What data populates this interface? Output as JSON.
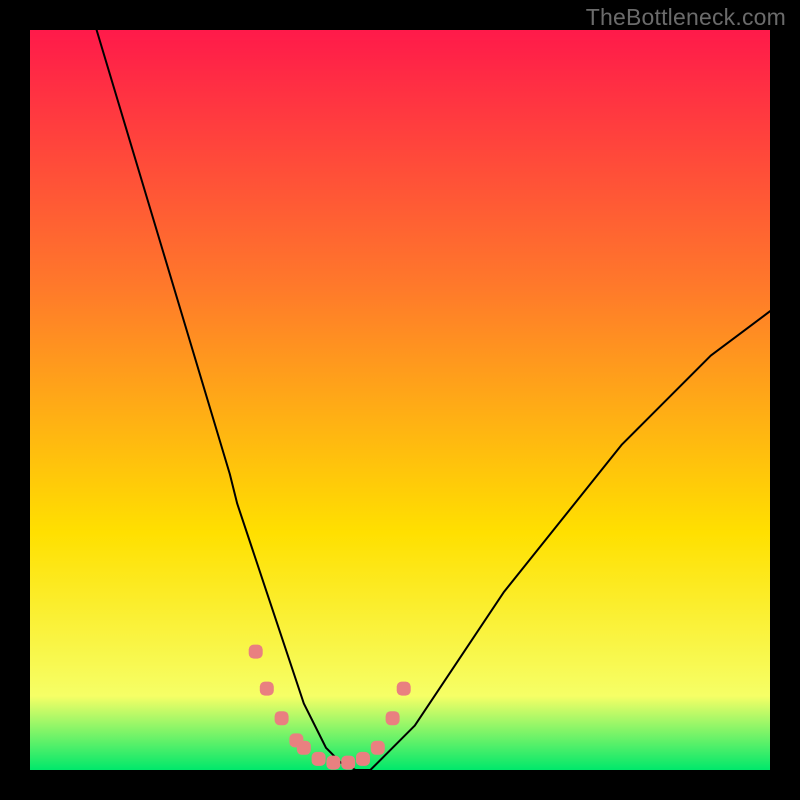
{
  "watermark": "TheBottleneck.com",
  "chart_data": {
    "type": "line",
    "title": "",
    "xlabel": "",
    "ylabel": "",
    "xlim": [
      0,
      100
    ],
    "ylim": [
      0,
      100
    ],
    "grid": false,
    "legend": false,
    "background_gradient": {
      "top_color": "#ff1a4a",
      "mid_color_1": "#ff7a2a",
      "mid_color_2": "#ffe000",
      "lower_color": "#f6ff66",
      "bottom_color": "#00e86b"
    },
    "series": [
      {
        "name": "bottleneck-curve",
        "color": "#000000",
        "x": [
          9,
          12,
          15,
          18,
          21,
          24,
          27,
          28,
          30,
          32,
          34,
          36,
          37,
          39,
          40,
          42,
          44,
          46,
          48,
          52,
          56,
          60,
          64,
          68,
          72,
          76,
          80,
          84,
          88,
          92,
          96,
          100
        ],
        "y": [
          100,
          90,
          80,
          70,
          60,
          50,
          40,
          36,
          30,
          24,
          18,
          12,
          9,
          5,
          3,
          1,
          0,
          0,
          2,
          6,
          12,
          18,
          24,
          29,
          34,
          39,
          44,
          48,
          52,
          56,
          59,
          62
        ]
      }
    ],
    "markers": [
      {
        "name": "highlight-dots",
        "color": "#e98080",
        "shape": "rounded-square",
        "x": [
          30.5,
          32,
          34,
          36,
          37,
          39,
          41,
          43,
          45,
          47,
          49,
          50.5
        ],
        "y": [
          16,
          11,
          7,
          4,
          3,
          1.5,
          1,
          1,
          1.5,
          3,
          7,
          11
        ]
      }
    ]
  }
}
